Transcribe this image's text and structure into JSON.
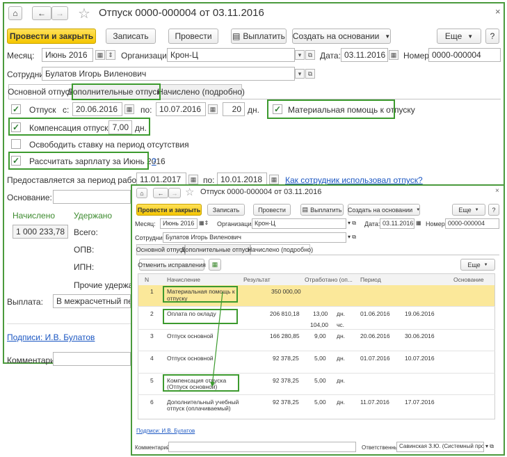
{
  "main": {
    "title": "Отпуск 0000-000004 от 03.11.2016",
    "toolbar": {
      "post_close": "Провести и закрыть",
      "save": "Записать",
      "post": "Провести",
      "pay": "Выплатить",
      "create_based": "Создать на основании",
      "more": "Еще",
      "help": "?"
    },
    "month_label": "Месяц:",
    "month_value": "Июнь 2016",
    "org_label": "Организация:",
    "org_value": "Крон-Ц",
    "date_label": "Дата:",
    "date_value": "03.11.2016",
    "number_label": "Номер:",
    "number_value": "0000-000004",
    "employee_label": "Сотрудник:",
    "employee_value": "Булатов Игорь Виленович",
    "tabs": [
      "Основной отпуск",
      "Дополнительные отпуска",
      "Начислено (подробно)"
    ],
    "vacation_label": "Отпуск",
    "from_label": "с:",
    "from_value": "20.06.2016",
    "to_label": "по:",
    "to_value": "10.07.2016",
    "days_value": "20",
    "days_unit": "дн.",
    "material_help": "Материальная помощь к отпуску",
    "compensation_label": "Компенсация отпуска",
    "compensation_value": "7,00",
    "compensation_unit": "дн.",
    "free_rate": "Освободить ставку на период отсутствия",
    "calc_salary": "Рассчитать зарплату за Июнь 2016",
    "calc_help": "?",
    "period_label": "Предоставляется за период работы с:",
    "period_from": "11.01.2017",
    "period_to_label": "по:",
    "period_to": "10.01.2018",
    "how_used_link": "Как сотрудник использовал отпуск?",
    "basis_label": "Основание:",
    "accrued_label": "Начислено",
    "withheld_label": "Удержано",
    "accrued_value": "1 000 233,78",
    "total_label": "Всего:",
    "opv_label": "ОПВ:",
    "ipn_label": "ИПН:",
    "other_label": "Прочие удержания",
    "payout_label": "Выплата:",
    "payout_value": "В межрасчетный период",
    "signatures_link": "Подписи: И.В. Булатов",
    "comment_label": "Комментарий:",
    "close_icon": "×"
  },
  "second": {
    "title": "Отпуск 0000-000004 от 03.11.2016",
    "toolbar": {
      "post_close": "Провести и закрыть",
      "save": "Записать",
      "post": "Провести",
      "pay": "Выплатить",
      "create_based": "Создать на основании",
      "more": "Еще",
      "help": "?"
    },
    "month_label": "Месяц:",
    "month_value": "Июнь 2016",
    "org_label": "Организация:",
    "org_value": "Крон-Ц",
    "date_label": "Дата:",
    "date_value": "03.11.2016",
    "number_label": "Номер:",
    "number_value": "0000-000004",
    "employee_label": "Сотрудник:",
    "employee_value": "Булатов Игорь Виленович",
    "tabs": [
      "Основной отпуск",
      "Дополнительные отпуска",
      "Начислено (подробно)"
    ],
    "cancel_fix": "Отменить исправления",
    "more": "Еще",
    "columns": [
      "N",
      "Начисление",
      "Результат",
      "Отработано (оп...",
      "Период",
      "",
      "Основание"
    ],
    "rows": [
      {
        "n": "1",
        "name1": "Материальная помощь к",
        "name2": "отпуску",
        "result": "350 000,00",
        "worked": "",
        "unit": "",
        "from": "",
        "to": ""
      },
      {
        "n": "2",
        "name1": "Оплата по окладу",
        "name2": "",
        "result": "206 810,18",
        "worked": "13,00",
        "unit": "дн.",
        "worked2": "104,00",
        "unit2": "чс.",
        "from": "01.06.2016",
        "to": "19.06.2016"
      },
      {
        "n": "3",
        "name1": "Отпуск основной",
        "name2": "",
        "result": "166 280,85",
        "worked": "9,00",
        "unit": "дн.",
        "from": "20.06.2016",
        "to": "30.06.2016"
      },
      {
        "n": "4",
        "name1": "Отпуск основной",
        "name2": "",
        "result": "92 378,25",
        "worked": "5,00",
        "unit": "дн.",
        "from": "01.07.2016",
        "to": "10.07.2016"
      },
      {
        "n": "5",
        "name1": "Компенсация отпуска",
        "name2": "(Отпуск основной)",
        "result": "92 378,25",
        "worked": "5,00",
        "unit": "дн.",
        "from": "",
        "to": ""
      },
      {
        "n": "6",
        "name1": "Дополнительный учебный",
        "name2": "отпуск (оплачиваемый)",
        "result": "92 378,25",
        "worked": "5,00",
        "unit": "дн.",
        "from": "11.07.2016",
        "to": "17.07.2016"
      }
    ],
    "signatures_link": "Подписи: И.В. Булатов",
    "comment_label": "Комментарий:",
    "responsible_label": "Ответственный:",
    "responsible_value": "Савинская З.Ю. (Системный програ",
    "close_icon": "×"
  },
  "colors": {
    "highlight": "#3c9a2e",
    "selected_row": "#fbe89a",
    "primary_button": "#f5c600",
    "link": "#1a56c2"
  }
}
